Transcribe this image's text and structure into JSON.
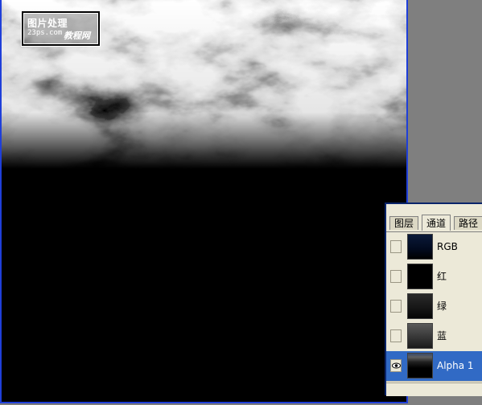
{
  "canvas": {
    "watermark": {
      "line1": "图片处理",
      "line2": "23ps.com",
      "line3": "教程网"
    },
    "frame_color": "#1f3fd9"
  },
  "channels_panel": {
    "tabs": [
      {
        "label": "图层",
        "active": false
      },
      {
        "label": "通道",
        "active": true
      },
      {
        "label": "路径",
        "active": false
      }
    ],
    "rows": [
      {
        "label": "RGB",
        "visible": false,
        "selected": false
      },
      {
        "label": "红",
        "visible": false,
        "selected": false
      },
      {
        "label": "绿",
        "visible": false,
        "selected": false
      },
      {
        "label": "蓝",
        "visible": false,
        "selected": false
      },
      {
        "label": "Alpha 1",
        "visible": true,
        "selected": true,
        "eye_icon": "eye-icon"
      }
    ],
    "selection_color": "#316ac5"
  }
}
